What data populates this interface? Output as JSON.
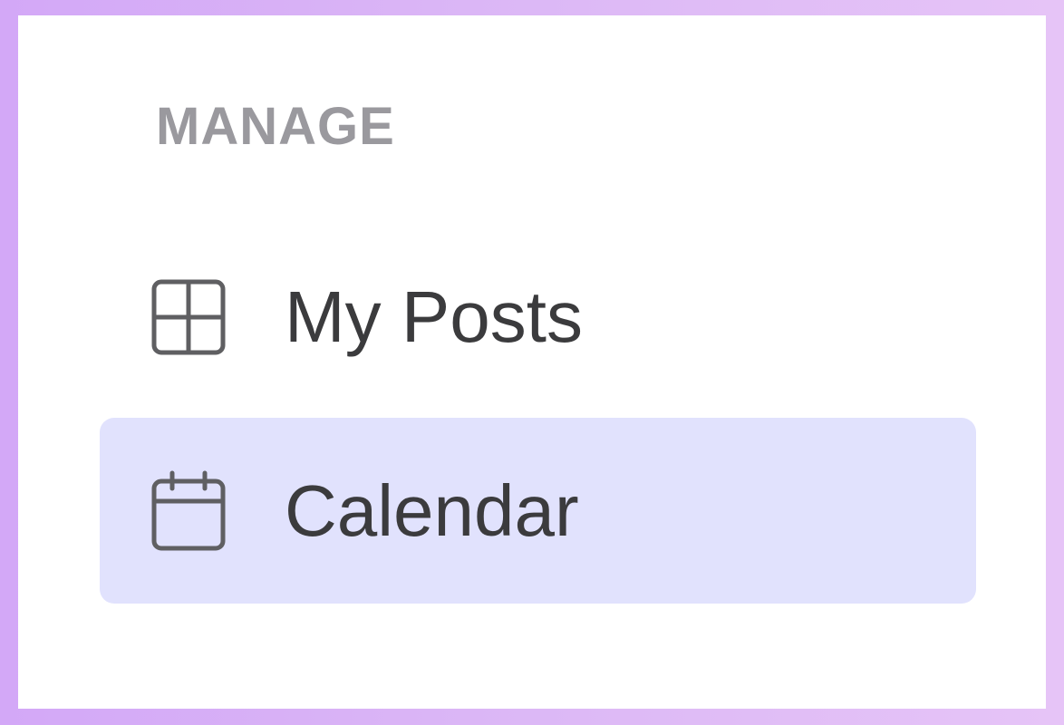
{
  "sidebar": {
    "section_title": "MANAGE",
    "items": [
      {
        "label": "My Posts",
        "icon": "grid-icon",
        "active": false
      },
      {
        "label": "Calendar",
        "icon": "calendar-icon",
        "active": true
      }
    ]
  },
  "colors": {
    "active_background": "#e1e2fd",
    "section_title": "#9a999e",
    "label_text": "#3b3b3d",
    "icon_stroke": "#5f5f62",
    "frame_gradient_start": "#d3a8f7",
    "frame_gradient_end": "#e6c4f7"
  }
}
